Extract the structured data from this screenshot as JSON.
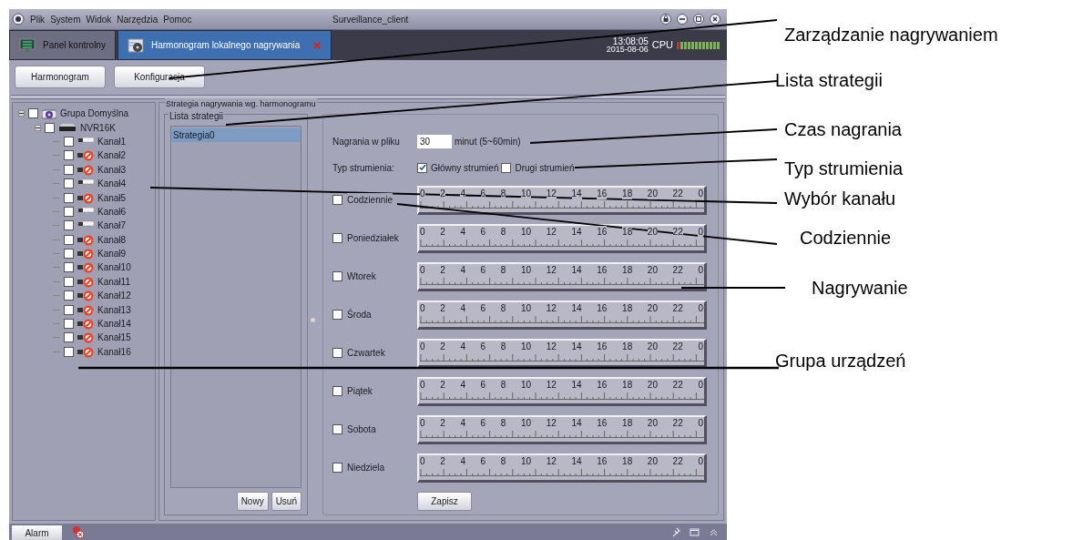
{
  "window": {
    "title": "Surveillance_client"
  },
  "menu": [
    "Plik",
    "System",
    "Widok",
    "Narzędzia",
    "Pomoc"
  ],
  "tabs": [
    {
      "label": "Panel kontrolny",
      "selected": false,
      "kind": "monitor"
    },
    {
      "label": "Harmonogram lokalnego nagrywania",
      "selected": true,
      "kind": "schedule"
    }
  ],
  "clock": {
    "time": "13:08:05",
    "date": "2015-08-06",
    "cpu_label": "CPU"
  },
  "toolbar": [
    {
      "label": "Harmonogram"
    },
    {
      "label": "Konfiguracja"
    }
  ],
  "device_tree": [
    {
      "label": "Grupa Domyślna",
      "kind": "group",
      "checked": false,
      "expanded": true,
      "children": [
        {
          "label": "NVR16K",
          "kind": "recorder",
          "checked": false,
          "expanded": true,
          "children": [
            {
              "label": "Kanał1",
              "kind": "camera",
              "checked": false
            },
            {
              "label": "Kanał2",
              "kind": "camera_off",
              "checked": false
            },
            {
              "label": "Kanał3",
              "kind": "camera_off",
              "checked": false
            },
            {
              "label": "Kanał4",
              "kind": "camera",
              "checked": false
            },
            {
              "label": "Kanał5",
              "kind": "camera_off",
              "checked": false
            },
            {
              "label": "Kanał6",
              "kind": "camera",
              "checked": false
            },
            {
              "label": "Kanał7",
              "kind": "camera",
              "checked": false
            },
            {
              "label": "Kanał8",
              "kind": "camera_off",
              "checked": false
            },
            {
              "label": "Kanał9",
              "kind": "camera_off",
              "checked": false
            },
            {
              "label": "Kanał10",
              "kind": "camera_off",
              "checked": false
            },
            {
              "label": "Kanał11",
              "kind": "camera_off",
              "checked": false
            },
            {
              "label": "Kanał12",
              "kind": "camera_off",
              "checked": false
            },
            {
              "label": "Kanał13",
              "kind": "camera_off",
              "checked": false
            },
            {
              "label": "Kanał14",
              "kind": "camera_off",
              "checked": false
            },
            {
              "label": "Kanał15",
              "kind": "camera_off",
              "checked": false
            },
            {
              "label": "Kanał16",
              "kind": "camera_off",
              "checked": false
            }
          ]
        }
      ]
    }
  ],
  "schedule": {
    "title": "Strategia nagrywania wg. harmonogramu",
    "strategy_list": {
      "title": "Lista strategii",
      "items": [
        {
          "label": "Strategia0",
          "selected": true
        }
      ],
      "buttons": [
        "Nowy",
        "Usuń"
      ]
    },
    "file_length": {
      "label": "Nagrania w pliku",
      "value": "30",
      "unit": "minut (5~60min)"
    },
    "stream_type": {
      "label": "Typ strumienia:",
      "options": [
        {
          "label": "Główny strumień",
          "checked": true
        },
        {
          "label": "Drugi strumień",
          "checked": false
        }
      ]
    },
    "days": [
      {
        "label": "Codziennie",
        "checked": false,
        "scale": [
          "0",
          "2",
          "4",
          "6",
          "8",
          "10",
          "12",
          "14",
          "16",
          "18",
          "20",
          "22",
          "0"
        ]
      },
      {
        "label": "Poniedziałek",
        "checked": false,
        "scale": [
          "0",
          "2",
          "4",
          "6",
          "8",
          "10",
          "12",
          "14",
          "16",
          "18",
          "20",
          "22",
          "0"
        ]
      },
      {
        "label": "Wtorek",
        "checked": false,
        "scale": [
          "0",
          "2",
          "4",
          "6",
          "8",
          "10",
          "12",
          "14",
          "16",
          "18",
          "20",
          "22",
          "0"
        ]
      },
      {
        "label": "Środa",
        "checked": false,
        "scale": [
          "0",
          "2",
          "4",
          "6",
          "8",
          "10",
          "12",
          "14",
          "16",
          "18",
          "20",
          "22",
          "0"
        ]
      },
      {
        "label": "Czwartek",
        "checked": false,
        "scale": [
          "0",
          "2",
          "4",
          "6",
          "8",
          "10",
          "12",
          "14",
          "16",
          "18",
          "20",
          "22",
          "0"
        ]
      },
      {
        "label": "Piątek",
        "checked": false,
        "scale": [
          "0",
          "2",
          "4",
          "6",
          "8",
          "10",
          "12",
          "14",
          "16",
          "18",
          "20",
          "22",
          "0"
        ]
      },
      {
        "label": "Sobota",
        "checked": false,
        "scale": [
          "0",
          "2",
          "4",
          "6",
          "8",
          "10",
          "12",
          "14",
          "16",
          "18",
          "20",
          "22",
          "0"
        ]
      },
      {
        "label": "Niedziela",
        "checked": false,
        "scale": [
          "0",
          "2",
          "4",
          "6",
          "8",
          "10",
          "12",
          "14",
          "16",
          "18",
          "20",
          "22",
          "0"
        ]
      }
    ],
    "save_button": "Zapisz"
  },
  "status_bar": {
    "alarm_button": "Alarm"
  },
  "annotations": [
    "Zarządzanie nagrywaniem",
    "Lista strategii",
    "Czas nagrania",
    "Typ strumienia",
    "Wybór kanału",
    "Codziennie",
    "Nagrywanie",
    "Grupa urządzeń"
  ]
}
